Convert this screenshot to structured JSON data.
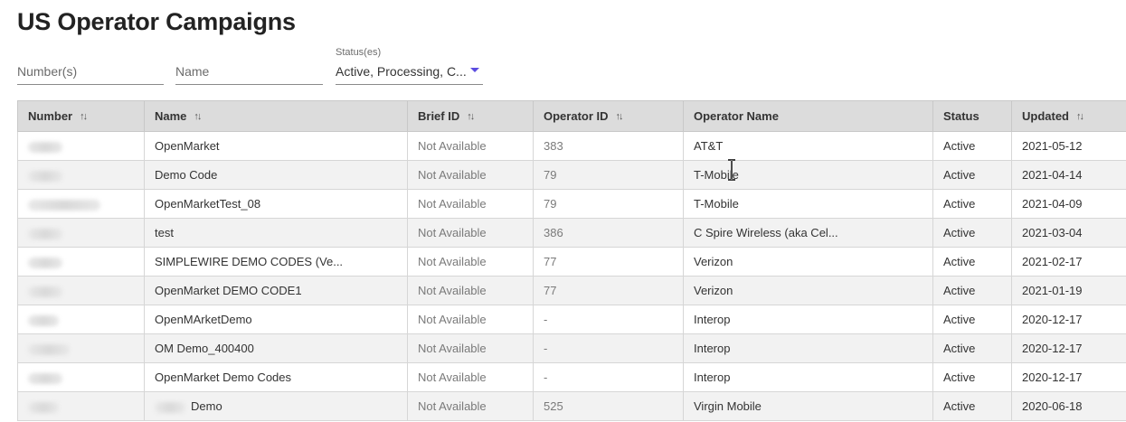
{
  "page": {
    "title": "US Operator Campaigns"
  },
  "filters": {
    "numbers_placeholder": "Number(s)",
    "name_placeholder": "Name",
    "status_label": "Status(es)",
    "status_value": "Active, Processing, C..."
  },
  "table": {
    "headers": {
      "number": "Number",
      "name": "Name",
      "brief_id": "Brief ID",
      "operator_id": "Operator ID",
      "operator_name": "Operator Name",
      "status": "Status",
      "updated": "Updated"
    },
    "rows": [
      {
        "name": "OpenMarket",
        "brief_id": "Not Available",
        "operator_id": "383",
        "operator_name": "AT&T",
        "status": "Active",
        "updated": "2021-05-12"
      },
      {
        "name": "Demo Code",
        "brief_id": "Not Available",
        "operator_id": "79",
        "operator_name": "T-Mobile",
        "status": "Active",
        "updated": "2021-04-14"
      },
      {
        "name": "OpenMarketTest_08",
        "brief_id": "Not Available",
        "operator_id": "79",
        "operator_name": "T-Mobile",
        "status": "Active",
        "updated": "2021-04-09"
      },
      {
        "name": "test",
        "brief_id": "Not Available",
        "operator_id": "386",
        "operator_name": "C Spire Wireless (aka Cel...",
        "status": "Active",
        "updated": "2021-03-04"
      },
      {
        "name": "SIMPLEWIRE DEMO CODES (Ve...",
        "brief_id": "Not Available",
        "operator_id": "77",
        "operator_name": "Verizon",
        "status": "Active",
        "updated": "2021-02-17"
      },
      {
        "name": "OpenMarket DEMO CODE1",
        "brief_id": "Not Available",
        "operator_id": "77",
        "operator_name": "Verizon",
        "status": "Active",
        "updated": "2021-01-19"
      },
      {
        "name": "OpenMArketDemo",
        "brief_id": "Not Available",
        "operator_id": "-",
        "operator_name": "Interop",
        "status": "Active",
        "updated": "2020-12-17"
      },
      {
        "name": "OM Demo_400400",
        "brief_id": "Not Available",
        "operator_id": "-",
        "operator_name": "Interop",
        "status": "Active",
        "updated": "2020-12-17"
      },
      {
        "name": "OpenMarket Demo Codes",
        "brief_id": "Not Available",
        "operator_id": "-",
        "operator_name": "Interop",
        "status": "Active",
        "updated": "2020-12-17"
      },
      {
        "name": "Demo",
        "brief_id": "Not Available",
        "operator_id": "525",
        "operator_name": "Virgin Mobile",
        "status": "Active",
        "updated": "2020-06-18"
      }
    ]
  },
  "icons": {
    "sort": "sort-arrows-icon",
    "dropdown": "chevron-down-icon",
    "cursor": "text-cursor-icon"
  },
  "colors": {
    "accent": "#5b4ce0",
    "header_bg": "#dcdcdc",
    "alt_row_bg": "#f2f2f2"
  }
}
